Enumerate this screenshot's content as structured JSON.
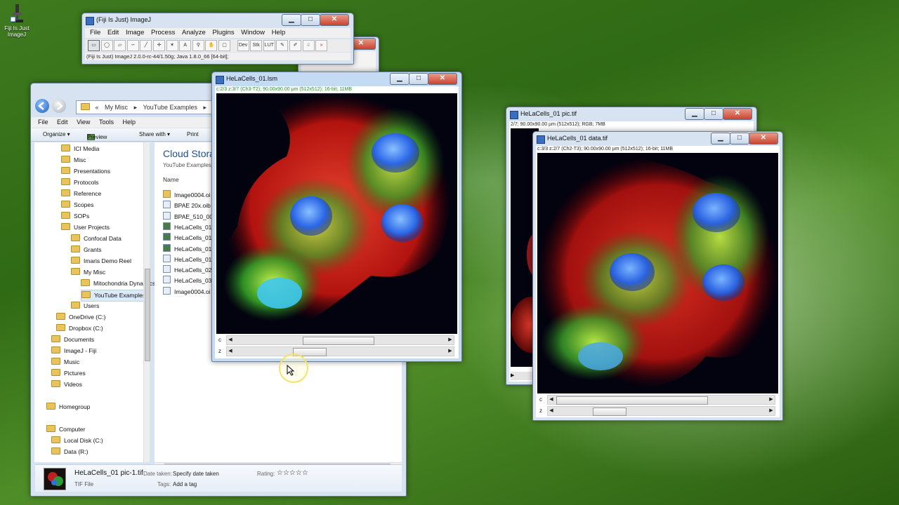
{
  "desktop_icon": {
    "label": "Fiji Is Just ImageJ"
  },
  "imagej": {
    "title": "(Fiji Is Just) ImageJ",
    "menu": [
      "File",
      "Edit",
      "Image",
      "Process",
      "Analyze",
      "Plugins",
      "Window",
      "Help"
    ],
    "tools": [
      "rectangle-tool",
      "oval-tool",
      "polygon-tool",
      "freehand-tool",
      "line-tool",
      "multipoint-tool",
      "wand-tool",
      "text-tool",
      "magnifier-tool",
      "hand-tool",
      "color-picker-tool",
      "dev-tool",
      "stk-tool",
      "lut-tool",
      "pencil-tool",
      "brush-tool",
      "flood-fill-tool",
      "more-tools"
    ],
    "tool_labels": {
      "dev": "Dev",
      "stk": "Stk",
      "lut": "LUT",
      "more": "»"
    },
    "status": "(Fiji Is Just) ImageJ 2.0.0-rc-44/1.50g; Java 1.8.0_66 [64-bit];"
  },
  "explorer": {
    "breadcrumb": [
      "«",
      "My Misc",
      "▸",
      "YouTube Examples",
      "▸"
    ],
    "menu": [
      "File",
      "Edit",
      "View",
      "Tools",
      "Help"
    ],
    "commands": [
      "Organize ▾",
      "Preview ▾",
      "Share with ▾",
      "Print"
    ],
    "nav": [
      {
        "label": "ICI Media",
        "indent": 1
      },
      {
        "label": "Misc",
        "indent": 1
      },
      {
        "label": "Presentations",
        "indent": 1
      },
      {
        "label": "Protocols",
        "indent": 1
      },
      {
        "label": "Reference",
        "indent": 1
      },
      {
        "label": "Scopes",
        "indent": 1
      },
      {
        "label": "SOPs",
        "indent": 1
      },
      {
        "label": "User Projects",
        "indent": 1
      },
      {
        "label": "Confocal Data",
        "indent": 2
      },
      {
        "label": "Grants",
        "indent": 2
      },
      {
        "label": "Imaris Demo Reel",
        "indent": 2
      },
      {
        "label": "My Misc",
        "indent": 2
      },
      {
        "label": "Mitochondria Dynamics",
        "indent": 3
      },
      {
        "label": "YouTube Examples",
        "indent": 3,
        "selected": true
      },
      {
        "label": "Users",
        "indent": 2
      },
      {
        "label": "OneDrive (C:)",
        "indent": 0.5
      },
      {
        "label": "Dropbox (C:)",
        "indent": 0.5
      },
      {
        "label": "Documents",
        "indent": 0
      },
      {
        "label": "ImageJ - Fiji",
        "indent": 0
      },
      {
        "label": "Music",
        "indent": 0
      },
      {
        "label": "Pictures",
        "indent": 0
      },
      {
        "label": "Videos",
        "indent": 0
      },
      {
        "label": "Homegroup",
        "indent": -0.5,
        "gap": true
      },
      {
        "label": "Computer",
        "indent": -0.5,
        "gap": true
      },
      {
        "label": "Local Disk (C:)",
        "indent": 0
      },
      {
        "label": "Data (R:)",
        "indent": 0
      }
    ],
    "content_title": "Cloud Stora",
    "content_sub": "YouTube Examples",
    "column_name": "Name",
    "files": [
      "Image0004.oi",
      "BPAE 20x.oib",
      "BPAE_510_001",
      "HeLaCells_01",
      "HeLaCells_01",
      "HeLaCells_01",
      "HeLaCells_01.",
      "HeLaCells_02.",
      "HeLaCells_03.",
      "Image0004.oi"
    ],
    "details": {
      "filename": "HeLaCells_01 pic-1.tif",
      "filetype": "TIF File",
      "date_key": "Date taken:",
      "date_val": "Specify date taken",
      "tags_key": "Tags:",
      "tags_val": "Add a tag",
      "rating_key": "Rating:",
      "rating_stars": "☆☆☆☆☆"
    }
  },
  "win_lsm": {
    "title": "HeLaCells_01.lsm",
    "info": "c:2/3 z:3/7 (Ch3-T2); 90.00x90.00 µm (512x512); 16-bit; 11MB",
    "slider_c": "c",
    "slider_z": "z"
  },
  "win_pic": {
    "title": "HeLaCells_01 pic.tif",
    "info": "2/7; 90.00x90.00 µm (512x512); RGB; 7MB"
  },
  "win_data": {
    "title": "HeLaCells_01 data.tif",
    "info": "c:3/3 z:2/7 (Ch2-T3); 90.00x90.00 µm (512x512); 16-bit; 11MB",
    "slider_c": "c",
    "slider_z": "z"
  },
  "caption_buttons": {
    "minimize": "▁",
    "maximize": "□",
    "close": "✕"
  }
}
